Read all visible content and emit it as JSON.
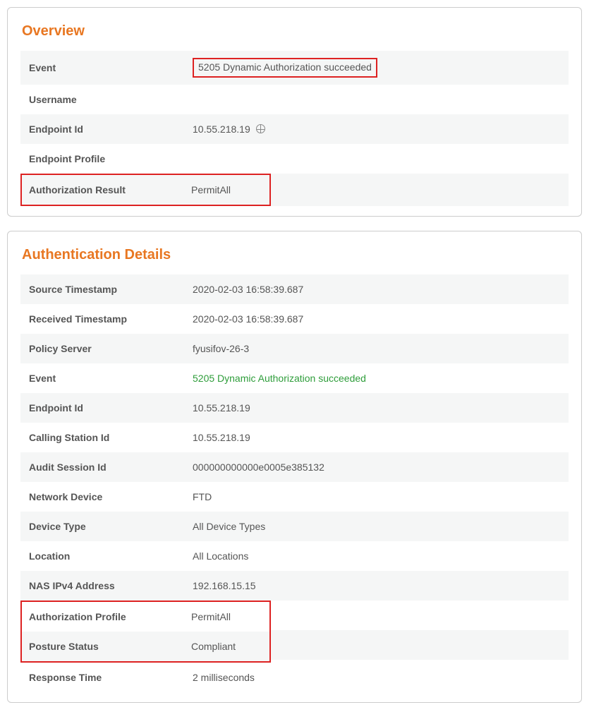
{
  "overview": {
    "title": "Overview",
    "rows": {
      "event": {
        "label": "Event",
        "value": "5205 Dynamic Authorization succeeded"
      },
      "username": {
        "label": "Username",
        "value": ""
      },
      "endpoint_id": {
        "label": "Endpoint Id",
        "value": "10.55.218.19"
      },
      "endpoint_profile": {
        "label": "Endpoint Profile",
        "value": ""
      },
      "auth_result": {
        "label": "Authorization Result",
        "value": "PermitAll"
      }
    }
  },
  "auth_details": {
    "title": "Authentication Details",
    "rows": {
      "source_ts": {
        "label": "Source Timestamp",
        "value": "2020-02-03 16:58:39.687"
      },
      "received_ts": {
        "label": "Received Timestamp",
        "value": "2020-02-03 16:58:39.687"
      },
      "policy_server": {
        "label": "Policy Server",
        "value": "fyusifov-26-3"
      },
      "event": {
        "label": "Event",
        "value": "5205 Dynamic Authorization succeeded"
      },
      "endpoint_id": {
        "label": "Endpoint Id",
        "value": "10.55.218.19"
      },
      "calling_station": {
        "label": "Calling Station Id",
        "value": "10.55.218.19"
      },
      "audit_session": {
        "label": "Audit Session Id",
        "value": "000000000000e0005e385132"
      },
      "network_device": {
        "label": "Network Device",
        "value": "FTD"
      },
      "device_type": {
        "label": "Device Type",
        "value": "All Device Types"
      },
      "location": {
        "label": "Location",
        "value": "All Locations"
      },
      "nas_ipv4": {
        "label": "NAS IPv4 Address",
        "value": "192.168.15.15"
      },
      "auth_profile": {
        "label": "Authorization Profile",
        "value": "PermitAll"
      },
      "posture_status": {
        "label": "Posture Status",
        "value": "Compliant"
      },
      "response_time": {
        "label": "Response Time",
        "value": "2 milliseconds"
      }
    }
  }
}
